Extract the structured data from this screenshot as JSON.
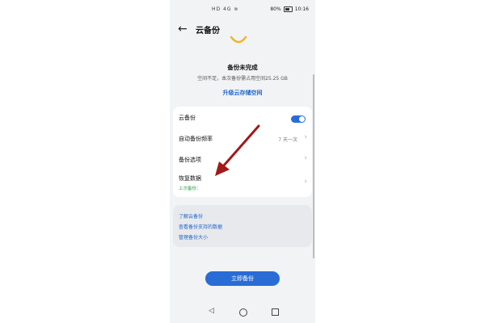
{
  "status_bar": {
    "left_icons": "HD 4G ≋",
    "battery": "80%",
    "time": "10:16"
  },
  "app_bar": {
    "title": "云备份",
    "back_icon": "arrow-left-icon"
  },
  "backup_status": {
    "title": "备份未完成",
    "subtitle": "空间不足，本次备份需占用空间25.25 GB",
    "upgrade_link": "升级云存储空间"
  },
  "settings": {
    "cloud_backup_label": "云备份",
    "cloud_backup_enabled": true,
    "auto_frequency_label": "自动备份频率",
    "auto_frequency_value": "7 天一次",
    "backup_options_label": "备份选项",
    "restore_label": "恢复数据",
    "last_backup_label": "上次备份："
  },
  "info": {
    "links": [
      "了解云备份",
      "查看备份支持的数据",
      "管理备份大小"
    ]
  },
  "actions": {
    "backup_now": "立即备份"
  },
  "colors": {
    "accent": "#2a6cd6",
    "link": "#1e63c8",
    "success": "#2aa142",
    "annotation_arrow": "#a11a1a",
    "smile": "#f0b429"
  }
}
